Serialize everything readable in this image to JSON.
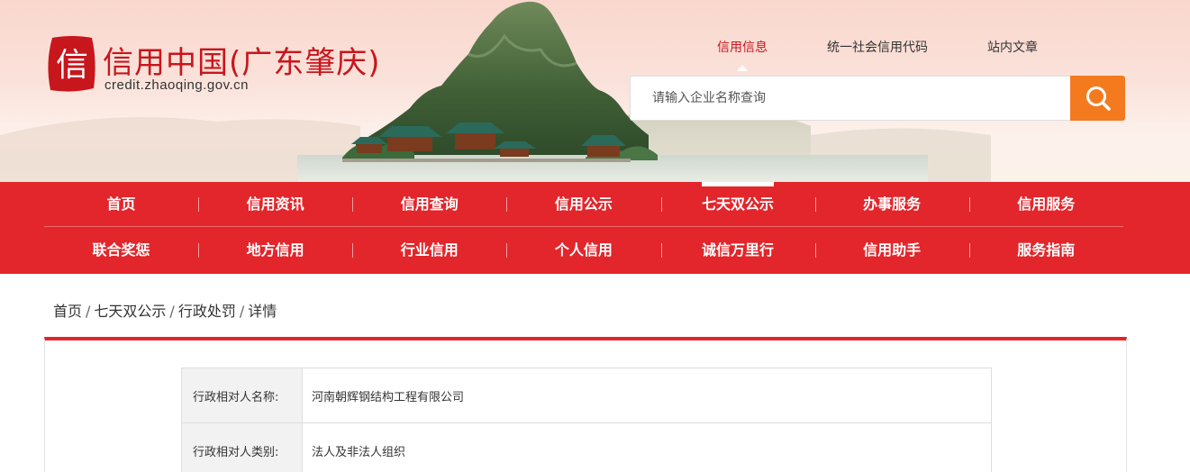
{
  "header": {
    "logo_char": "信",
    "title": "信用中国(广东肇庆)",
    "domain": "credit.zhaoqing.gov.cn",
    "top_links": [
      {
        "label": "信用信息",
        "active": true
      },
      {
        "label": "统一社会信用代码",
        "active": false
      },
      {
        "label": "站内文章",
        "active": false
      }
    ],
    "search": {
      "placeholder": "请输入企业名称查询",
      "icon": "search-icon"
    },
    "colors": {
      "brand_red": "#c8161d",
      "search_button": "#f47a20"
    }
  },
  "nav": {
    "background": "#e2262b",
    "row1": [
      "首页",
      "信用资讯",
      "信用查询",
      "信用公示",
      "七天双公示",
      "办事服务",
      "信用服务"
    ],
    "row2": [
      "联合奖惩",
      "地方信用",
      "行业信用",
      "个人信用",
      "诚信万里行",
      "信用助手",
      "服务指南"
    ],
    "current": "七天双公示"
  },
  "breadcrumb": [
    "首页",
    "七天双公示",
    "行政处罚",
    "详情"
  ],
  "detail": {
    "rows": [
      {
        "label": "行政相对人名称:",
        "value": "河南朝辉钢结构工程有限公司"
      },
      {
        "label": "行政相对人类别:",
        "value": "法人及非法人组织"
      }
    ]
  }
}
